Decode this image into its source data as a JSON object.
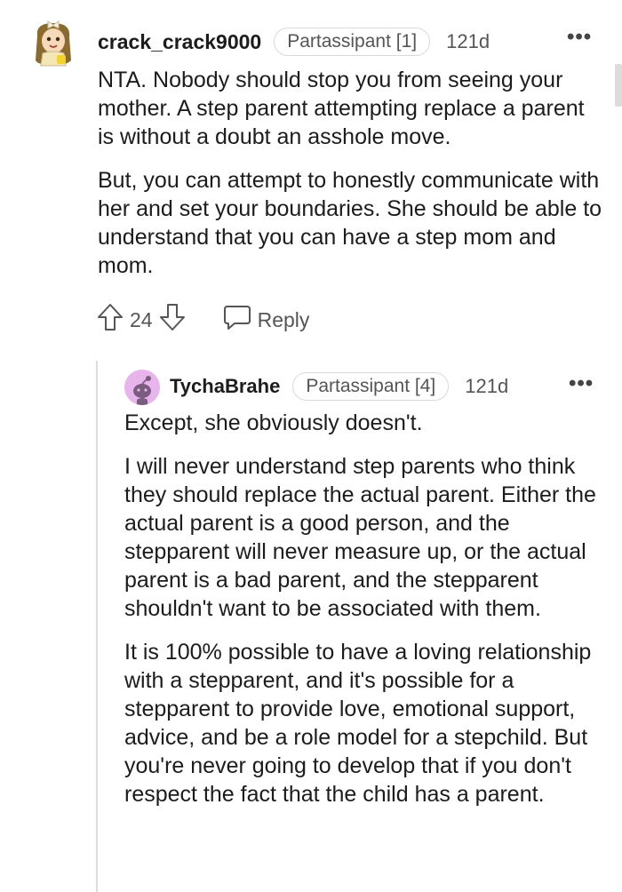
{
  "comments": [
    {
      "username": "crack_crack9000",
      "flair": "Partassipant [1]",
      "age": "121d",
      "more_icon": "•••",
      "paragraphs": [
        "NTA. Nobody should stop you from seeing your mother. A step parent attempting replace a parent is without a doubt an asshole move.",
        "But, you can attempt to honestly communicate with her and set your boundaries. She should be able to understand that you can have a step mom and mom."
      ],
      "votes": "24",
      "reply_label": "Reply"
    },
    {
      "username": "TychaBrahe",
      "flair": "Partassipant [4]",
      "age": "121d",
      "more_icon": "•••",
      "paragraphs": [
        "Except, she obviously doesn't.",
        "I will never understand step parents who think they should replace the actual parent. Either the actual parent is a good person, and the stepparent will never measure up, or the actual parent is a bad parent, and the stepparent shouldn't want to be associated with them.",
        "It is 100% possible to have a loving relationship with a stepparent, and it's possible for a stepparent to provide love, emotional support, advice, and be a role model for a stepchild. But you're never going to develop that if you don't respect the fact that the child has a parent."
      ]
    }
  ],
  "icons": {
    "avatar_1": "cartoon-girl-avatar-icon",
    "avatar_2": "snoo-avatar-icon",
    "upvote": "upvote-arrow-icon",
    "downvote": "downvote-arrow-icon",
    "reply": "speech-bubble-icon",
    "more": "more-options-icon"
  },
  "colors": {
    "text": "#1c1c1c",
    "muted": "#555555",
    "border": "#dadada",
    "avatar_2_bg": "#e8b4ec"
  }
}
